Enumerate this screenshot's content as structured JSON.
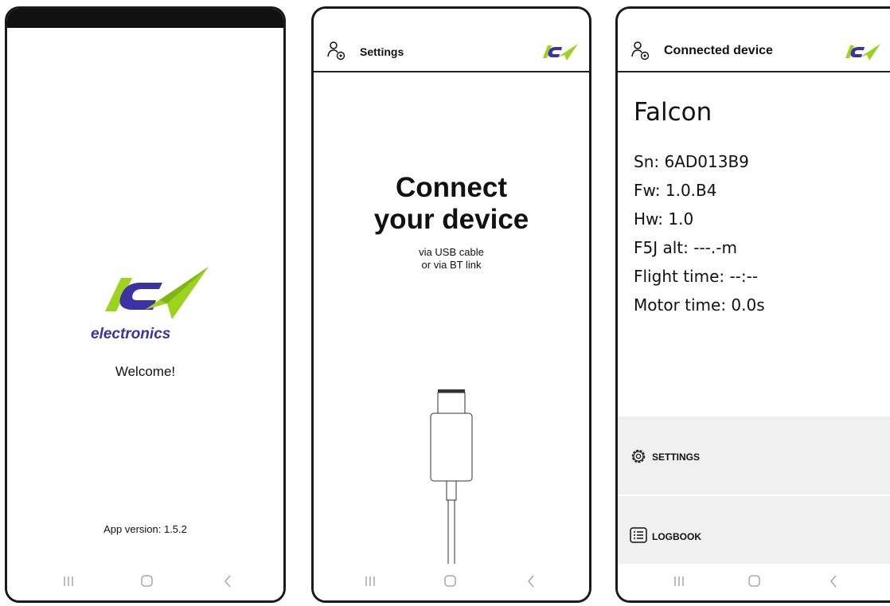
{
  "colors": {
    "brand_green": "#9cd31c",
    "brand_blue": "#3b33a3",
    "border": "#1a1a1a",
    "panel": "#f0f0f0"
  },
  "splash": {
    "logo_text": "electronics",
    "welcome": "Welcome!",
    "app_version": "App version: 1.5.2"
  },
  "connect": {
    "header_title": "Settings",
    "title_line1": "Connect",
    "title_line2": "your device",
    "sub_line1": "via USB cable",
    "sub_line2": "or via BT link"
  },
  "device": {
    "header_title": "Connected device",
    "name": "Falcon",
    "sn": "Sn: 6AD013B9",
    "fw": "Fw: 1.0.B4",
    "hw": "Hw: 1.0",
    "f5j_alt": "F5J alt: ---.-m",
    "flight_time": "Flight time: --:--",
    "motor_time": "Motor time: 0.0s",
    "settings_label": "SETTINGS",
    "logbook_label": "LOGBOOK"
  },
  "icons": {
    "user": "user-settings-icon",
    "gear": "gear-icon",
    "list": "list-icon",
    "recents": "recents-icon",
    "home": "home-icon",
    "back": "back-icon",
    "usb": "usb-cable-icon"
  }
}
